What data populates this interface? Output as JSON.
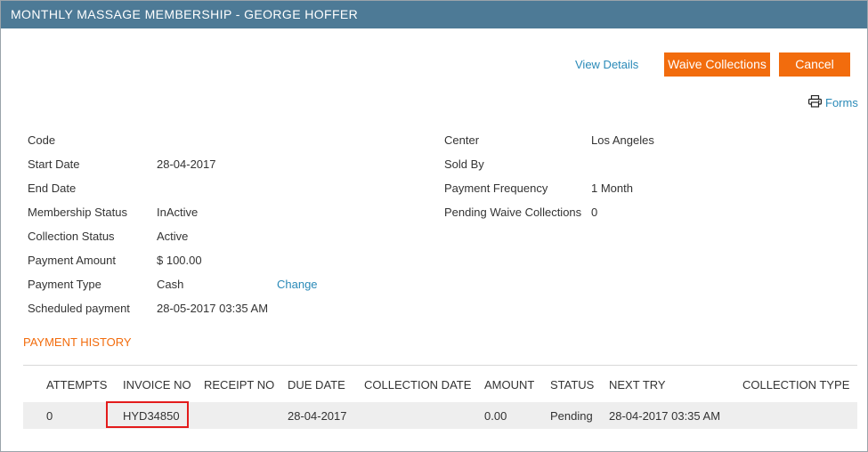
{
  "window": {
    "title": "MONTHLY MASSAGE MEMBERSHIP - GEORGE HOFFER"
  },
  "actions": {
    "view_details": "View Details",
    "waive_collections": "Waive Collections",
    "cancel": "Cancel",
    "forms": "Forms"
  },
  "details_left": [
    {
      "label": "Code",
      "value": ""
    },
    {
      "label": "Start Date",
      "value": "28-04-2017"
    },
    {
      "label": "End Date",
      "value": ""
    },
    {
      "label": "Membership Status",
      "value": "InActive"
    },
    {
      "label": "Collection Status",
      "value": "Active"
    },
    {
      "label": "Payment Amount",
      "value": "$ 100.00"
    },
    {
      "label": "Payment Type",
      "value": "Cash",
      "action": "Change"
    },
    {
      "label": "Scheduled payment",
      "value": "28-05-2017 03:35 AM"
    }
  ],
  "details_right": [
    {
      "label": "Center",
      "value": "Los Angeles"
    },
    {
      "label": "Sold By",
      "value": ""
    },
    {
      "label": "Payment Frequency",
      "value": "1 Month"
    },
    {
      "label": "Pending Waive Collections",
      "value": "0"
    }
  ],
  "payment_history": {
    "title": "PAYMENT HISTORY",
    "columns": [
      "ATTEMPTS",
      "INVOICE NO",
      "RECEIPT NO",
      "DUE DATE",
      "COLLECTION DATE",
      "AMOUNT",
      "STATUS",
      "NEXT TRY",
      "COLLECTION TYPE"
    ],
    "rows": [
      {
        "attempts": "0",
        "invoice_no": "HYD34850",
        "receipt_no": "",
        "due_date": "28-04-2017",
        "collection_date": "",
        "amount": "0.00",
        "status": "Pending",
        "next_try": "28-04-2017 03:35 AM",
        "collection_type": ""
      }
    ]
  },
  "colors": {
    "header": "#4d7a96",
    "accent": "#f26c0d",
    "link": "#2a8ab8",
    "highlight": "#e31b1b"
  }
}
